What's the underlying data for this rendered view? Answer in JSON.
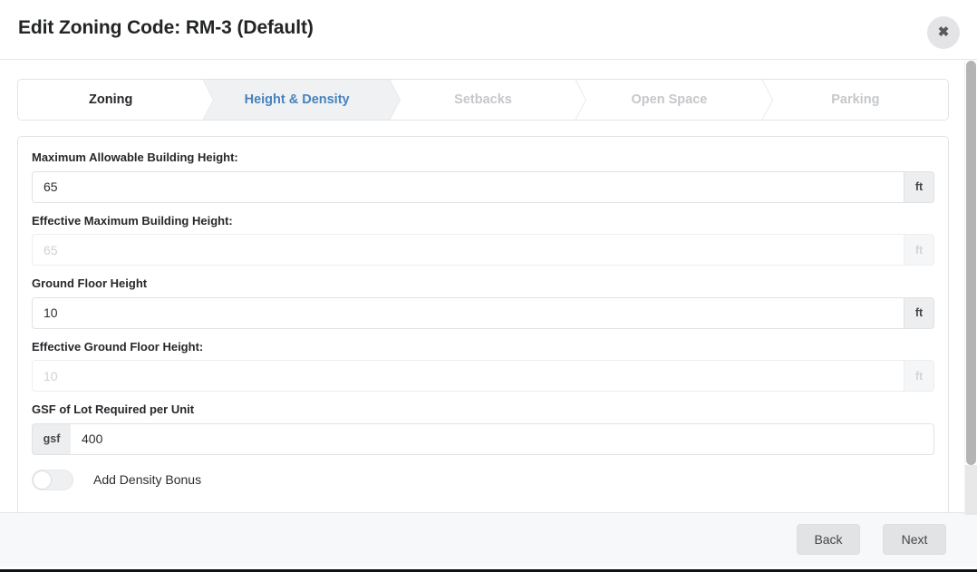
{
  "header": {
    "title": "Edit Zoning Code: RM-3 (Default)",
    "close_label": "✖"
  },
  "wizard": {
    "steps": [
      {
        "label": "Zoning",
        "state": "done"
      },
      {
        "label": "Height & Density",
        "state": "active"
      },
      {
        "label": "Setbacks",
        "state": "upcoming"
      },
      {
        "label": "Open Space",
        "state": "upcoming"
      },
      {
        "label": "Parking",
        "state": "upcoming"
      }
    ],
    "active_color": "#4683bd",
    "done_color": "#26282b",
    "upcoming_color": "#c5c7ca"
  },
  "form": {
    "fields": [
      {
        "label": "Maximum Allowable Building Height:",
        "value": "65",
        "placeholder": "",
        "unit": "ft",
        "unit_position": "right",
        "disabled": false
      },
      {
        "label": "Effective Maximum Building Height:",
        "value": "",
        "placeholder": "65",
        "unit": "ft",
        "unit_position": "right",
        "disabled": true
      },
      {
        "label": "Ground Floor Height",
        "value": "10",
        "placeholder": "",
        "unit": "ft",
        "unit_position": "right",
        "disabled": false
      },
      {
        "label": "Effective Ground Floor Height:",
        "value": "",
        "placeholder": "10",
        "unit": "ft",
        "unit_position": "right",
        "disabled": true
      },
      {
        "label": "GSF of Lot Required per Unit",
        "value": "400",
        "placeholder": "",
        "unit": "gsf",
        "unit_position": "left",
        "disabled": false
      }
    ],
    "toggle": {
      "label": "Add Density Bonus",
      "checked": false
    }
  },
  "footer": {
    "back_label": "Back",
    "next_label": "Next"
  }
}
